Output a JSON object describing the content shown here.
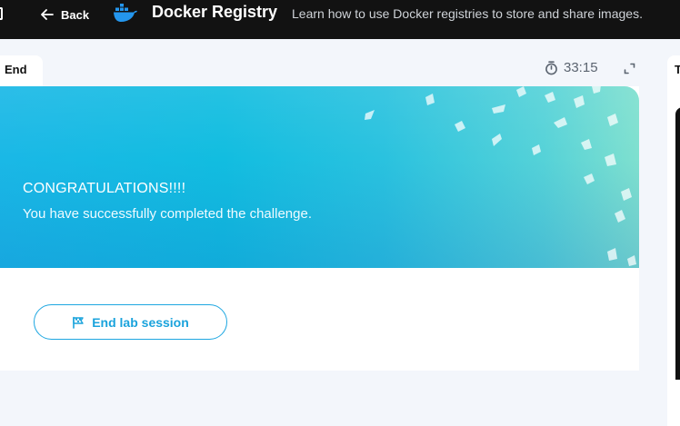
{
  "header": {
    "back_label": "Back",
    "title": "Docker Registry",
    "subtitle": "Learn how to use Docker registries to store and share images."
  },
  "tab": {
    "label": "End"
  },
  "right_panel": {
    "label": "T"
  },
  "timer": {
    "value": "33:15"
  },
  "banner": {
    "heading": "CONGRATULATIONS!!!!",
    "message": "You have successfully completed the challenge."
  },
  "actions": {
    "end_session_label": "End lab session"
  },
  "colors": {
    "topbar": "#121212",
    "accent": "#1aa3dc",
    "banner_start": "#1ab8e6",
    "banner_end": "#7fe0cf"
  },
  "icons": {
    "back": "arrow-left-icon",
    "logo": "docker-whale-icon",
    "timer": "stopwatch-icon",
    "expand": "expand-icon",
    "end": "flag-icon"
  }
}
